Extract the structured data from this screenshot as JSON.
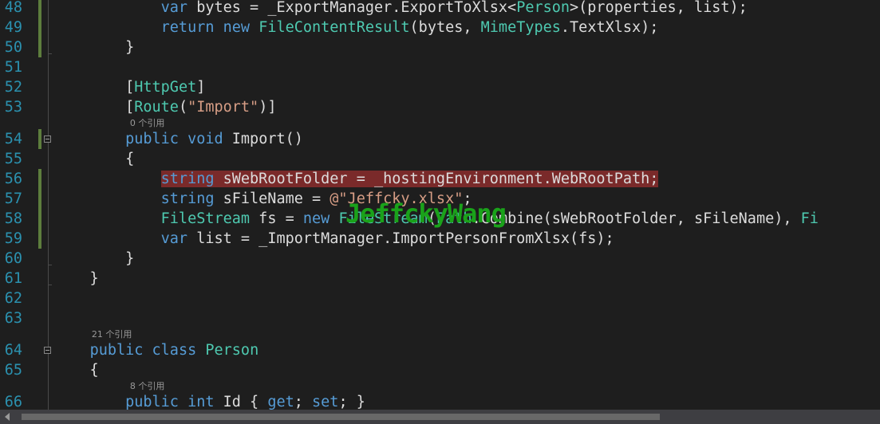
{
  "editor": {
    "lines": [
      {
        "num": "48",
        "segments": [
          {
            "t": "            "
          },
          {
            "t": "var",
            "c": "kw"
          },
          {
            "t": " bytes = _ExportManager.ExportToXlsx<"
          },
          {
            "t": "Person",
            "c": "ty"
          },
          {
            "t": ">(properties, list);"
          }
        ]
      },
      {
        "num": "49",
        "segments": [
          {
            "t": "            "
          },
          {
            "t": "return",
            "c": "kw"
          },
          {
            "t": " "
          },
          {
            "t": "new",
            "c": "kw"
          },
          {
            "t": " "
          },
          {
            "t": "FileContentResult",
            "c": "ty"
          },
          {
            "t": "(bytes, "
          },
          {
            "t": "MimeTypes",
            "c": "ty"
          },
          {
            "t": ".TextXlsx);"
          }
        ]
      },
      {
        "num": "50",
        "segments": [
          {
            "t": "        }"
          }
        ]
      },
      {
        "num": "51",
        "segments": [
          {
            "t": ""
          }
        ]
      },
      {
        "num": "52",
        "segments": [
          {
            "t": "        ["
          },
          {
            "t": "HttpGet",
            "c": "ty"
          },
          {
            "t": "]"
          }
        ]
      },
      {
        "num": "53",
        "segments": [
          {
            "t": "        ["
          },
          {
            "t": "Route",
            "c": "ty"
          },
          {
            "t": "("
          },
          {
            "t": "\"Import\"",
            "c": "st"
          },
          {
            "t": ")]"
          }
        ]
      },
      {
        "num": "54",
        "segments": [
          {
            "t": "        "
          },
          {
            "t": "public",
            "c": "kw"
          },
          {
            "t": " "
          },
          {
            "t": "void",
            "c": "kw"
          },
          {
            "t": " Import()"
          }
        ]
      },
      {
        "num": "55",
        "segments": [
          {
            "t": "        {"
          }
        ]
      },
      {
        "num": "56",
        "segments": [
          {
            "t": "            "
          },
          {
            "t": "string",
            "c": "kw",
            "hl": true
          },
          {
            "t": " sWebRootFolder = _hostingEnvironment.WebRootPath;",
            "hl": true
          }
        ]
      },
      {
        "num": "57",
        "segments": [
          {
            "t": "            "
          },
          {
            "t": "string",
            "c": "kw"
          },
          {
            "t": " sFileName = "
          },
          {
            "t": "@\"Jeffcky.xlsx\"",
            "c": "st"
          },
          {
            "t": ";"
          }
        ]
      },
      {
        "num": "58",
        "segments": [
          {
            "t": "            "
          },
          {
            "t": "FileStream",
            "c": "ty"
          },
          {
            "t": " fs = "
          },
          {
            "t": "new",
            "c": "kw"
          },
          {
            "t": " "
          },
          {
            "t": "FileStream",
            "c": "ty"
          },
          {
            "t": "("
          },
          {
            "t": "Path",
            "c": "ty"
          },
          {
            "t": ".Combine(sWebRootFolder, sFileName), "
          },
          {
            "t": "Fi",
            "c": "ty"
          }
        ]
      },
      {
        "num": "59",
        "segments": [
          {
            "t": "            "
          },
          {
            "t": "var",
            "c": "kw"
          },
          {
            "t": " list = _ImportManager.ImportPersonFromXlsx(fs);"
          }
        ]
      },
      {
        "num": "60",
        "segments": [
          {
            "t": "        }"
          }
        ]
      },
      {
        "num": "61",
        "segments": [
          {
            "t": "    }"
          }
        ]
      },
      {
        "num": "62",
        "segments": [
          {
            "t": ""
          }
        ]
      },
      {
        "num": "63",
        "segments": [
          {
            "t": ""
          }
        ]
      },
      {
        "num": "64",
        "segments": [
          {
            "t": "    "
          },
          {
            "t": "public",
            "c": "kw"
          },
          {
            "t": " "
          },
          {
            "t": "class",
            "c": "kw"
          },
          {
            "t": " "
          },
          {
            "t": "Person",
            "c": "ty"
          }
        ]
      },
      {
        "num": "65",
        "segments": [
          {
            "t": "    {"
          }
        ]
      },
      {
        "num": "66",
        "segments": [
          {
            "t": "        "
          },
          {
            "t": "public",
            "c": "kw"
          },
          {
            "t": " "
          },
          {
            "t": "int",
            "c": "kw"
          },
          {
            "t": " Id { "
          },
          {
            "t": "get",
            "c": "kw"
          },
          {
            "t": "; "
          },
          {
            "t": "set",
            "c": "kw"
          },
          {
            "t": "; }"
          }
        ]
      }
    ],
    "codelens": [
      {
        "before_line": "54",
        "indent": 8,
        "text": "0 个引用"
      },
      {
        "before_line": "64",
        "indent": 4,
        "text": "21 个引用"
      },
      {
        "before_line": "66",
        "indent": 8,
        "text": "8 个引用"
      }
    ],
    "watermark": "JeffckyWang",
    "colors": {
      "background": "#1e1e1e",
      "line_number": "#2b91af",
      "keyword": "#569cd6",
      "type": "#4ec9b0",
      "string": "#d69d85",
      "text": "#dcdcdc",
      "breakpoint_highlight": "#7a2a2a",
      "change_bar": "#5d7d3d",
      "watermark": "#1aa21a"
    }
  }
}
